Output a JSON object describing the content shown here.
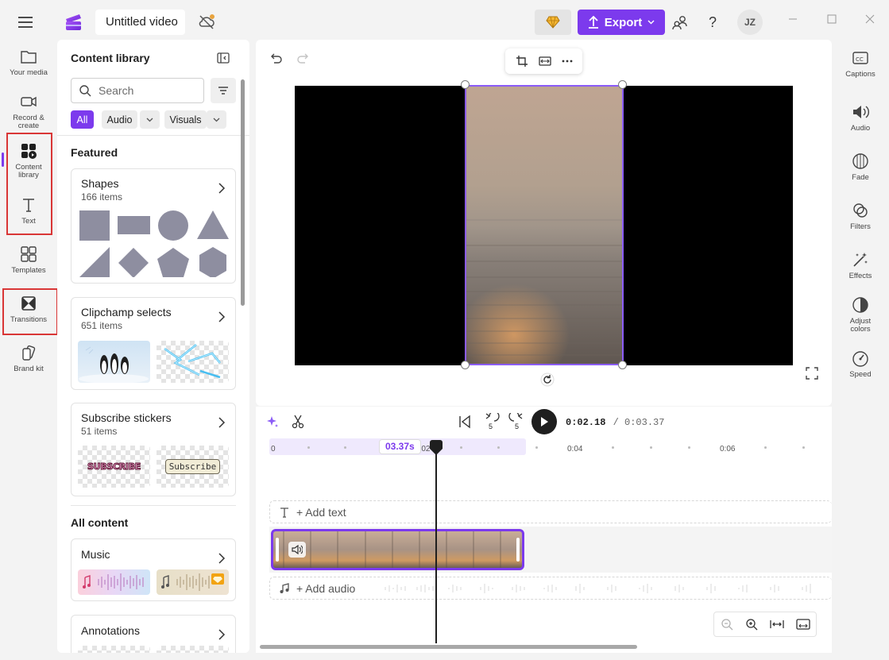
{
  "app": {
    "project_title": "Untitled video",
    "export_label": "Export",
    "user_initials": "JZ",
    "accent": "#7c3aed"
  },
  "left_rail": [
    {
      "label": "Your media",
      "icon": "folder-icon"
    },
    {
      "label": "Record & create",
      "icon": "camera-icon"
    },
    {
      "label": "Content library",
      "icon": "content-library-icon",
      "active": true
    },
    {
      "label": "Text",
      "icon": "text-icon"
    },
    {
      "label": "Templates",
      "icon": "templates-icon"
    },
    {
      "label": "Transitions",
      "icon": "transitions-icon"
    },
    {
      "label": "Brand kit",
      "icon": "brand-kit-icon"
    }
  ],
  "library": {
    "title": "Content library",
    "search_placeholder": "Search",
    "chips": {
      "all": "All",
      "audio": "Audio",
      "visuals": "Visuals"
    },
    "featured_heading": "Featured",
    "all_content_heading": "All content",
    "cards": [
      {
        "title": "Shapes",
        "count": "166 items"
      },
      {
        "title": "Clipchamp selects",
        "count": "651 items"
      },
      {
        "title": "Subscribe stickers",
        "count": "51 items"
      },
      {
        "title": "Music",
        "count": ""
      },
      {
        "title": "Annotations",
        "count": ""
      }
    ],
    "stickers": {
      "sticker_1": "SUBSCRIBE",
      "sticker_2": "Subscribe"
    }
  },
  "timeline": {
    "current_time": "0:02.18",
    "total_time": "/ 0:03.37",
    "clip_duration_label": "03.37s",
    "ticks": [
      "0",
      "0:02",
      "0:04",
      "0:06"
    ],
    "add_text": "+ Add text",
    "add_audio": "+ Add audio",
    "skip_back": "5",
    "skip_forward": "5"
  },
  "right_rail": [
    {
      "label": "Captions",
      "icon": "captions-icon"
    },
    {
      "label": "Audio",
      "icon": "speaker-icon"
    },
    {
      "label": "Fade",
      "icon": "fade-icon"
    },
    {
      "label": "Filters",
      "icon": "filters-icon"
    },
    {
      "label": "Effects",
      "icon": "magic-wand-icon"
    },
    {
      "label": "Adjust colors",
      "icon": "adjust-colors-icon"
    },
    {
      "label": "Speed",
      "icon": "speedometer-icon"
    }
  ]
}
